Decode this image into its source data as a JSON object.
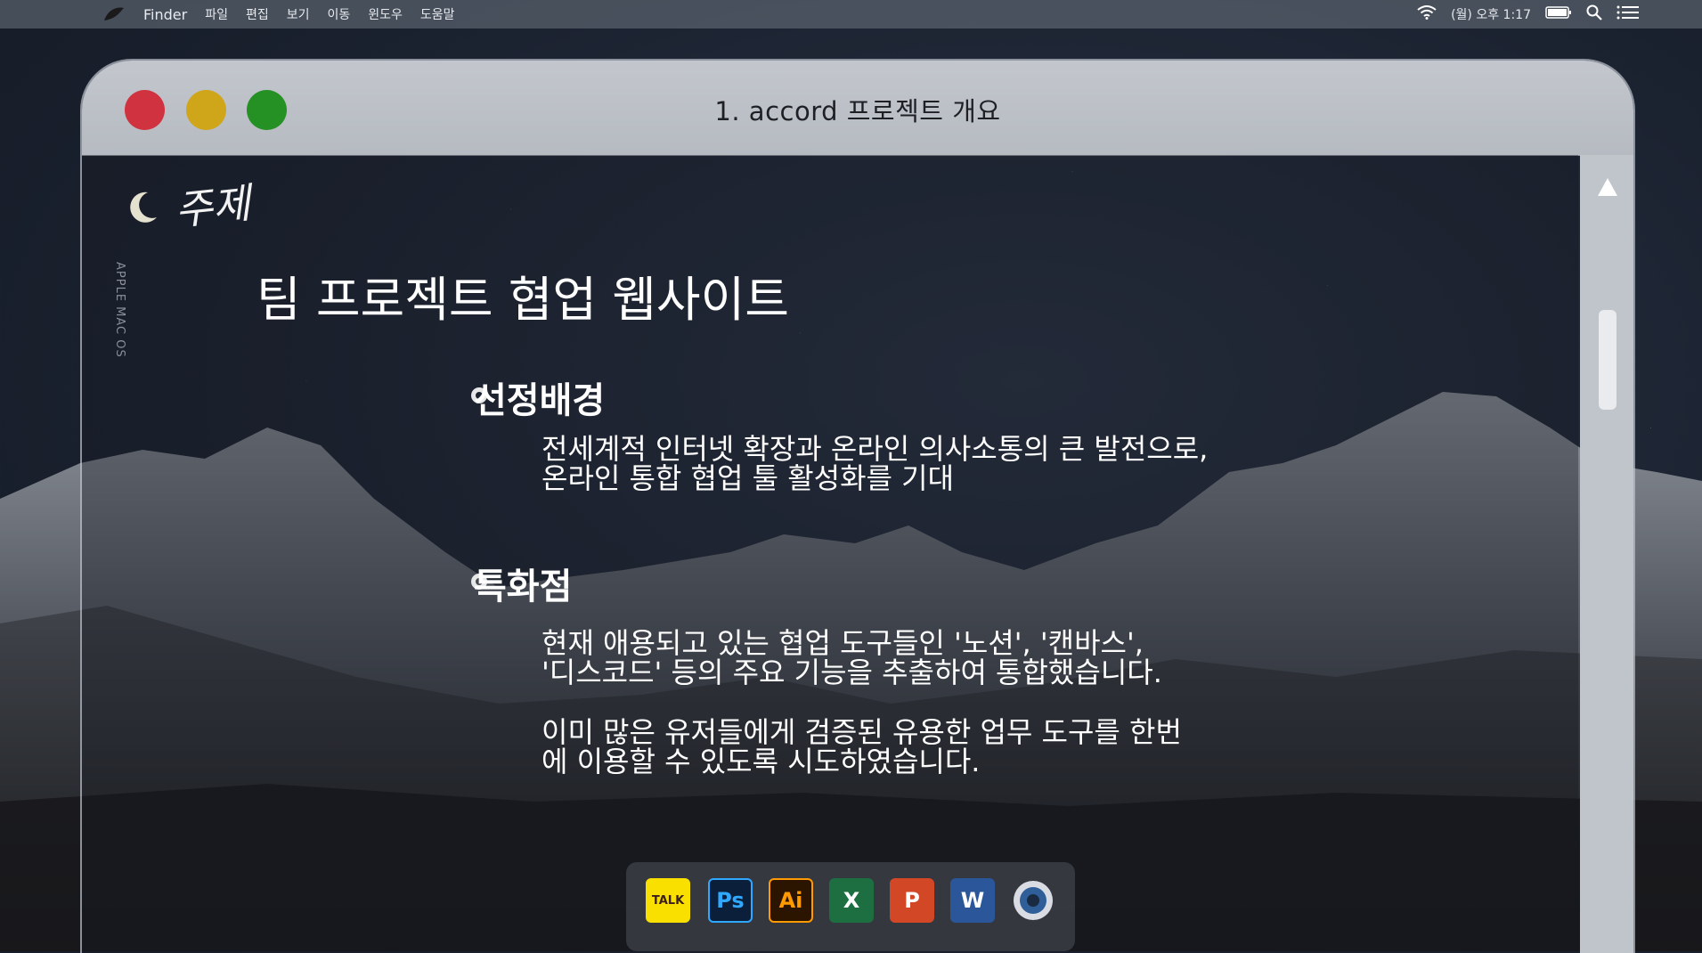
{
  "menubar": {
    "app_name": "Finder",
    "menus": [
      "파일",
      "편집",
      "보기",
      "이동",
      "윈도우",
      "도움말"
    ],
    "clock": "(월) 오후 1:17"
  },
  "window": {
    "title": "1. accord 프로젝트 개요"
  },
  "content": {
    "topic_label": "주제",
    "vertical_text": "APPLE MAC OS",
    "heading": "팀 프로젝트 협업 웹사이트",
    "sections": [
      {
        "title": "선정배경",
        "paragraphs": [
          "전세계적 인터넷 확장과 온라인 의사소통의 큰 발전으로,\n온라인 통합 협업 툴 활성화를 기대"
        ]
      },
      {
        "title": "특화점",
        "paragraphs": [
          "현재 애용되고 있는 협업 도구들인 '노션', '캔바스',\n'디스코드' 등의 주요 기능을 추출하여 통합했습니다.",
          "이미 많은 유저들에게 검증된 유용한 업무 도구를 한번\n에 이용할 수 있도록 시도하였습니다."
        ]
      }
    ]
  },
  "dock": {
    "apps": [
      {
        "name": "kakaotalk",
        "label": "TALK",
        "bg": "#f9e000",
        "fg": "#3b1e1e",
        "border": "#f9e000"
      },
      {
        "name": "photoshop",
        "label": "Ps",
        "bg": "#0b1f3b",
        "fg": "#31a8ff",
        "border": "#31a8ff"
      },
      {
        "name": "illustrator",
        "label": "Ai",
        "bg": "#2b1500",
        "fg": "#ff9a00",
        "border": "#ff9a00"
      },
      {
        "name": "excel",
        "label": "X",
        "bg": "#1d6f42",
        "fg": "#ffffff",
        "border": "#1d6f42"
      },
      {
        "name": "powerpoint",
        "label": "P",
        "bg": "#d24726",
        "fg": "#ffffff",
        "border": "#d24726"
      },
      {
        "name": "word",
        "label": "W",
        "bg": "#2b579a",
        "fg": "#ffffff",
        "border": "#2b579a"
      },
      {
        "name": "aperture",
        "label": "",
        "bg": "#3b6fb0",
        "fg": "#ffffff",
        "border": "#3b6fb0"
      }
    ]
  },
  "colors": {
    "close": "#d0323f",
    "minimize": "#cfa519",
    "zoom": "#259024"
  }
}
